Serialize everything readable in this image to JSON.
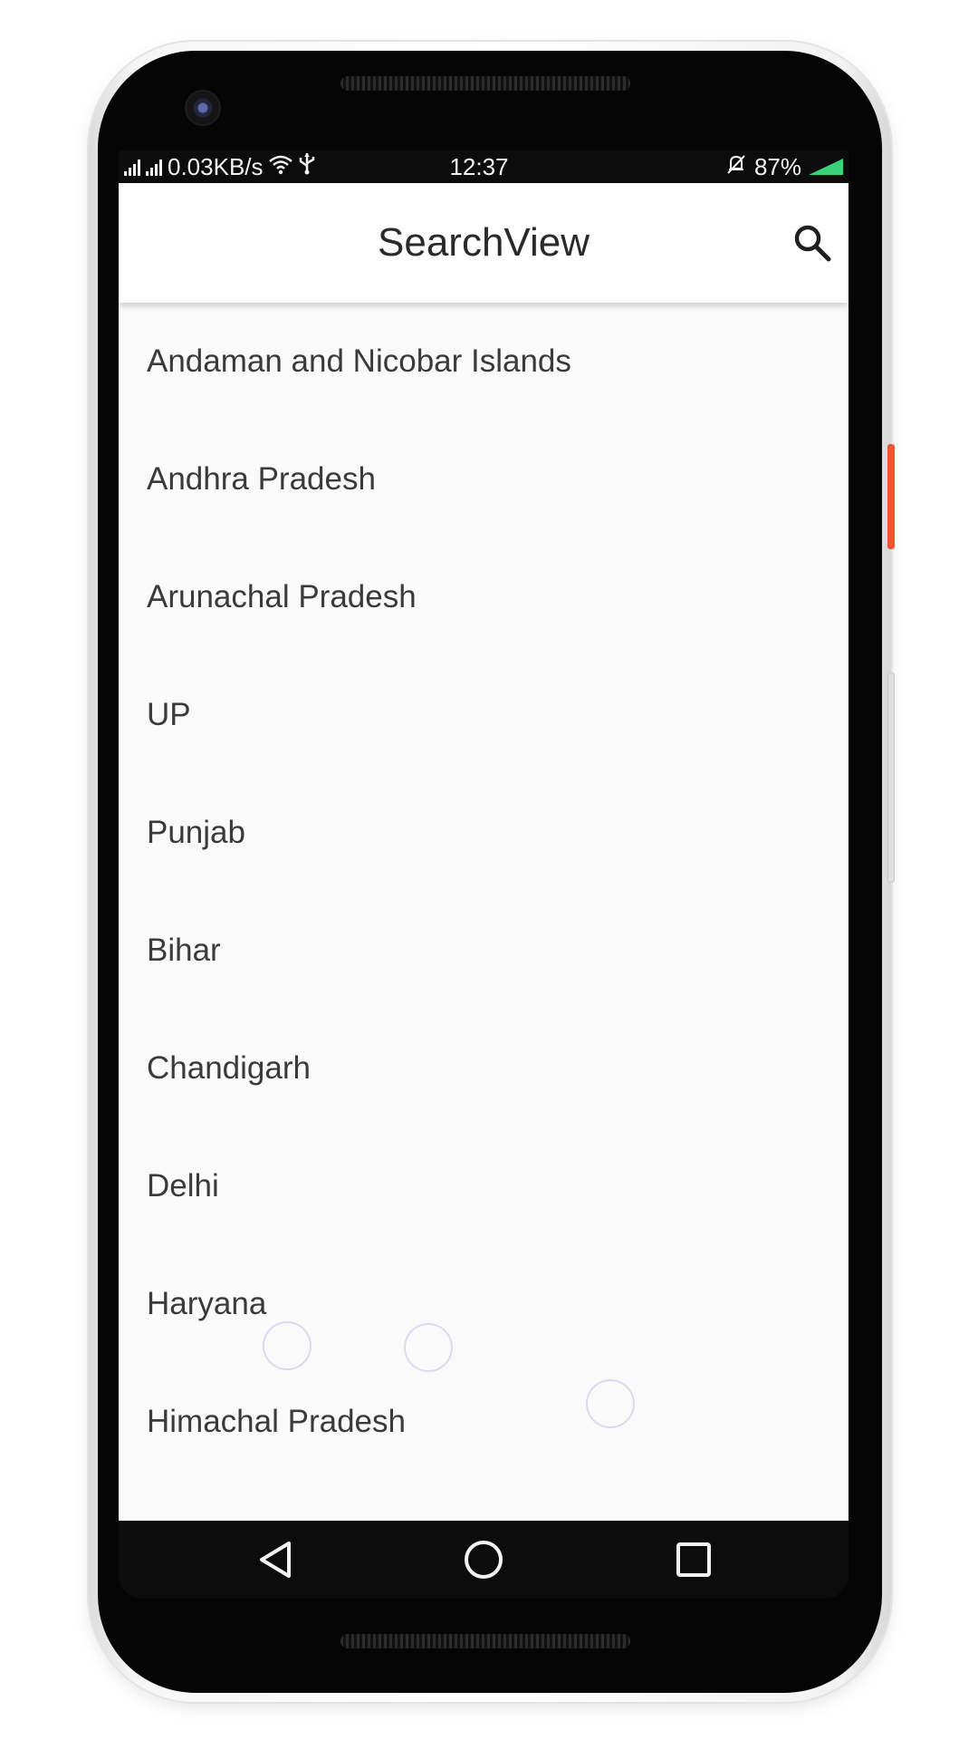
{
  "status_bar": {
    "net_speed": "0.03KB/s",
    "time": "12:37",
    "battery": "87%",
    "icons": [
      "signal-icon",
      "signal-icon",
      "wifi-icon",
      "usb-icon",
      "mute-bell-icon",
      "battery-icon"
    ]
  },
  "app_bar": {
    "title": "SearchView",
    "search_icon": "search-icon"
  },
  "list": {
    "items": [
      "Andaman and Nicobar Islands",
      "Andhra Pradesh",
      "Arunachal Pradesh",
      "UP",
      "Punjab",
      "Bihar",
      "Chandigarh",
      "Delhi",
      "Haryana",
      "Himachal Pradesh"
    ]
  },
  "nav_bar": {
    "buttons": [
      "back-icon",
      "home-icon",
      "recents-icon"
    ]
  },
  "colors": {
    "app_bar_bg": "#ffffff",
    "list_bg": "#fafafa",
    "text": "#3a3a3a",
    "status_bar_bg": "#0c0c0c",
    "battery": "#3bd27a",
    "power_button": "#f0552f"
  }
}
